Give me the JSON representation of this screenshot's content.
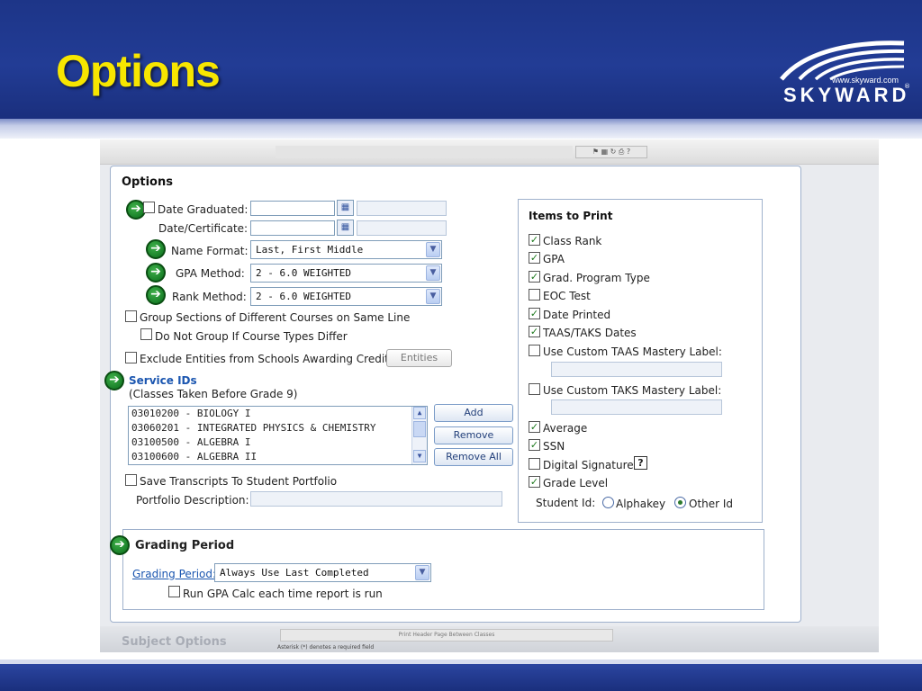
{
  "slide": {
    "title": "Options",
    "logo": {
      "url": "www.skyward.com",
      "word": "SKYWARD",
      "reg": "®"
    }
  },
  "toolbar": {
    "icons_text": "⚑ ▦ ↻ ⎙ ?"
  },
  "options": {
    "title": "Options",
    "date_graduated_label": "Date Graduated:",
    "date_certificate_label": "Date/Certificate:",
    "name_format_label": "Name Format:",
    "name_format_value": "Last, First Middle",
    "gpa_method_label": "GPA Method:",
    "gpa_method_value": "2 - 6.0 WEIGHTED",
    "rank_method_label": "Rank Method:",
    "rank_method_value": "2 - 6.0 WEIGHTED",
    "group_sections_label": "Group Sections of Different Courses on Same Line",
    "do_not_group_label": "Do Not Group If Course Types Differ",
    "exclude_entities_label": "Exclude Entities from Schools Awarding Credit",
    "entities_button": "Entities",
    "service_ids_title": "Service IDs",
    "service_ids_sub": "(Classes Taken Before Grade 9)",
    "service_ids": [
      "03010200 - BIOLOGY I",
      "03060201 - INTEGRATED PHYSICS & CHEMISTRY",
      "03100500 - ALGEBRA I",
      "03100600 - ALGEBRA II"
    ],
    "add_button": "Add",
    "remove_button": "Remove",
    "remove_all_button": "Remove All",
    "save_transcripts_label": "Save Transcripts To Student Portfolio",
    "portfolio_description_label": "Portfolio Description:"
  },
  "items_to_print": {
    "title": "Items to Print",
    "items": [
      {
        "label": "Class Rank",
        "checked": true
      },
      {
        "label": "GPA",
        "checked": true
      },
      {
        "label": "Grad. Program Type",
        "checked": true
      },
      {
        "label": "EOC Test",
        "checked": false
      },
      {
        "label": "Date Printed",
        "checked": true
      },
      {
        "label": "TAAS/TAKS Dates",
        "checked": true
      },
      {
        "label": "Use Custom TAAS Mastery Label:",
        "checked": false
      },
      {
        "label": "Use Custom TAKS Mastery Label:",
        "checked": false
      },
      {
        "label": "Average",
        "checked": true
      },
      {
        "label": "SSN",
        "checked": true
      },
      {
        "label": "Digital Signature",
        "checked": false
      },
      {
        "label": "Grade Level",
        "checked": true
      }
    ],
    "help_glyph": "?",
    "student_id_label": "Student Id:",
    "student_id_options": [
      "Alphakey",
      "Other Id"
    ],
    "student_id_selected": "Other Id"
  },
  "grading": {
    "title": "Grading Period",
    "period_label": "Grading Period:",
    "period_value": "Always Use Last Completed",
    "run_gpa_label": "Run GPA Calc each time report is run"
  },
  "subject": {
    "title": "Subject Options",
    "print_header_label": "Print Header Page Between Classes",
    "asterisk_note": "Asterisk (*) denotes a required field"
  },
  "colors": {
    "header_blue": "#223c95",
    "title_yellow": "#f7e600",
    "callout_green": "#1f8a2b",
    "link_blue": "#1b56b0"
  }
}
